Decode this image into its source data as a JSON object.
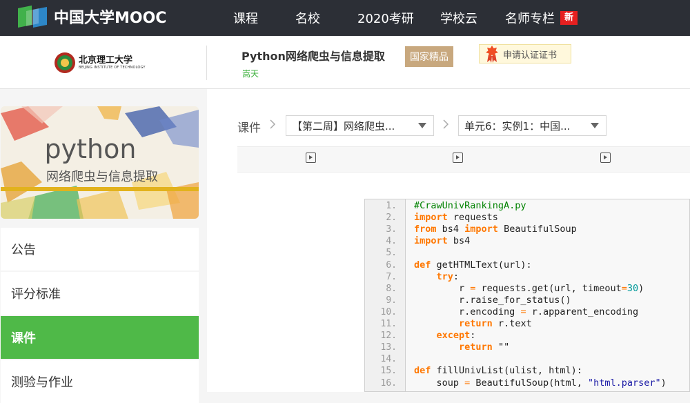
{
  "site": {
    "logo_text": "中国大学MOOC",
    "nav": [
      "课程",
      "名校",
      "2020考研",
      "学校云",
      "名师专栏"
    ],
    "nav_badge": "新"
  },
  "course": {
    "school_cn": "北京理工大学",
    "school_en": "BEIJING INSTITUTE OF TECHNOLOGY",
    "title": "Python网络爬虫与信息提取",
    "teacher": "嵩天",
    "tag": "国家精品",
    "cert_label": "申请认证证书"
  },
  "cover": {
    "title": "python",
    "subtitle": "网络爬虫与信息提取"
  },
  "sidebar": {
    "items": [
      {
        "label": "公告",
        "active": false
      },
      {
        "label": "评分标准",
        "active": false
      },
      {
        "label": "课件",
        "active": true
      },
      {
        "label": "测验与作业",
        "active": false
      }
    ]
  },
  "breadcrumb": {
    "root": "课件",
    "week_select": "【第二周】网络爬虫...",
    "unit_select": "单元6：实例1：中国..."
  },
  "code": {
    "lines": [
      [
        {
          "t": "#CrawUnivRankingA.py",
          "c": "cm"
        }
      ],
      [
        {
          "t": "import",
          "c": "kw"
        },
        {
          "t": " requests"
        }
      ],
      [
        {
          "t": "from",
          "c": "kw"
        },
        {
          "t": " bs4 "
        },
        {
          "t": "import",
          "c": "kw"
        },
        {
          "t": " BeautifulSoup"
        }
      ],
      [
        {
          "t": "import",
          "c": "kw"
        },
        {
          "t": " bs4"
        }
      ],
      [],
      [
        {
          "t": "def",
          "c": "kw"
        },
        {
          "t": " getHTMLText(url):"
        }
      ],
      [
        {
          "t": "    "
        },
        {
          "t": "try",
          "c": "kw"
        },
        {
          "t": ":"
        }
      ],
      [
        {
          "t": "        r "
        },
        {
          "t": "=",
          "c": "op"
        },
        {
          "t": " requests.get(url, timeout"
        },
        {
          "t": "=",
          "c": "op"
        },
        {
          "t": "30",
          "c": "num"
        },
        {
          "t": ")"
        }
      ],
      [
        {
          "t": "        r.raise_for_status()"
        }
      ],
      [
        {
          "t": "        r.encoding "
        },
        {
          "t": "=",
          "c": "op"
        },
        {
          "t": " r.apparent_encoding"
        }
      ],
      [
        {
          "t": "        "
        },
        {
          "t": "return",
          "c": "kw"
        },
        {
          "t": " r.text"
        }
      ],
      [
        {
          "t": "    "
        },
        {
          "t": "except",
          "c": "kw"
        },
        {
          "t": ":"
        }
      ],
      [
        {
          "t": "        "
        },
        {
          "t": "return",
          "c": "kw"
        },
        {
          "t": " \"\""
        }
      ],
      [],
      [
        {
          "t": "def",
          "c": "kw"
        },
        {
          "t": " fillUnivList(ulist, html):"
        }
      ],
      [
        {
          "t": "    soup "
        },
        {
          "t": "=",
          "c": "op"
        },
        {
          "t": " BeautifulSoup(html, "
        },
        {
          "t": "\"html.parser\"",
          "c": "str"
        },
        {
          "t": ")"
        }
      ]
    ]
  }
}
